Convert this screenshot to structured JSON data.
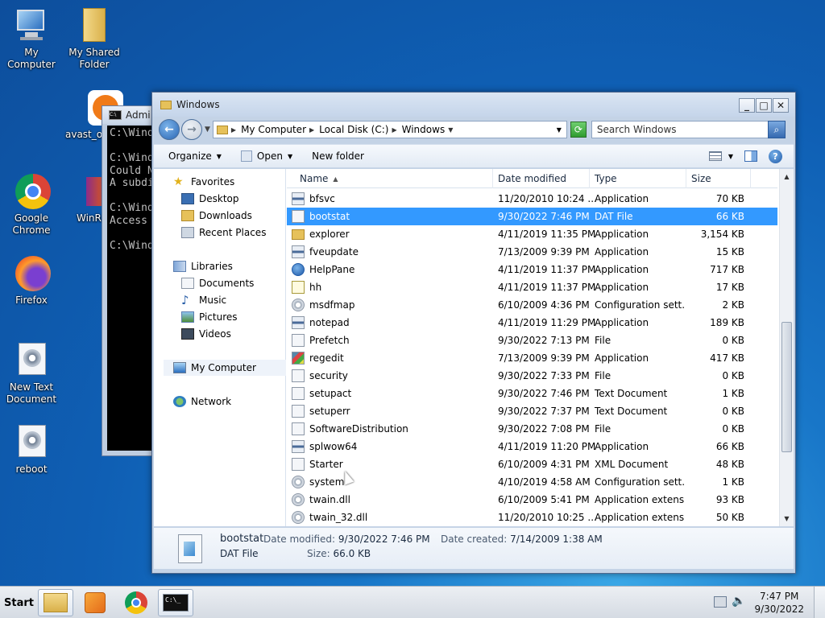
{
  "desktop": {
    "icons": [
      {
        "label": "My Computer"
      },
      {
        "label": "My Shared Folder"
      },
      {
        "label": "avast_on"
      },
      {
        "label": "Google Chrome"
      },
      {
        "label": "WinRa"
      },
      {
        "label": "Firefox"
      },
      {
        "label": "New Text Document"
      },
      {
        "label": "reboot"
      }
    ]
  },
  "cmd": {
    "title": "Admi",
    "lines": "C:\\Wind\n\nC:\\Wind\nCould N\nA subdi\n\nC:\\Wind\nAccess\n\nC:\\Wind"
  },
  "window": {
    "title": "Windows",
    "address": {
      "crumbs": [
        "My Computer",
        "Local Disk (C:)",
        "Windows"
      ]
    },
    "search_placeholder": "Search Windows",
    "toolbar": {
      "organize": "Organize",
      "open": "Open",
      "new_folder": "New folder"
    },
    "nav": {
      "favorites": "Favorites",
      "desktop": "Desktop",
      "downloads": "Downloads",
      "recent": "Recent Places",
      "libraries": "Libraries",
      "documents": "Documents",
      "music": "Music",
      "pictures": "Pictures",
      "videos": "Videos",
      "my_computer": "My Computer",
      "network": "Network"
    },
    "columns": {
      "name": "Name",
      "date": "Date modified",
      "type": "Type",
      "size": "Size"
    },
    "files": [
      {
        "name": "bfsvc",
        "date": "11/20/2010 10:24 ...",
        "type": "Application",
        "size": "70 KB",
        "icon": "app"
      },
      {
        "name": "bootstat",
        "date": "9/30/2022 7:46 PM",
        "type": "DAT File",
        "size": "66 KB",
        "icon": "file",
        "selected": true
      },
      {
        "name": "explorer",
        "date": "4/11/2019 11:35 PM",
        "type": "Application",
        "size": "3,154 KB",
        "icon": "folder"
      },
      {
        "name": "fveupdate",
        "date": "7/13/2009 9:39 PM",
        "type": "Application",
        "size": "15 KB",
        "icon": "app"
      },
      {
        "name": "HelpPane",
        "date": "4/11/2019 11:37 PM",
        "type": "Application",
        "size": "717 KB",
        "icon": "help"
      },
      {
        "name": "hh",
        "date": "4/11/2019 11:37 PM",
        "type": "Application",
        "size": "17 KB",
        "icon": "qmark"
      },
      {
        "name": "msdfmap",
        "date": "6/10/2009 4:36 PM",
        "type": "Configuration sett...",
        "size": "2 KB",
        "icon": "gear"
      },
      {
        "name": "notepad",
        "date": "4/11/2019 11:29 PM",
        "type": "Application",
        "size": "189 KB",
        "icon": "app"
      },
      {
        "name": "Prefetch",
        "date": "9/30/2022 7:13 PM",
        "type": "File",
        "size": "0 KB",
        "icon": "file"
      },
      {
        "name": "regedit",
        "date": "7/13/2009 9:39 PM",
        "type": "Application",
        "size": "417 KB",
        "icon": "reg"
      },
      {
        "name": "security",
        "date": "9/30/2022 7:33 PM",
        "type": "File",
        "size": "0 KB",
        "icon": "file"
      },
      {
        "name": "setupact",
        "date": "9/30/2022 7:46 PM",
        "type": "Text Document",
        "size": "1 KB",
        "icon": "file"
      },
      {
        "name": "setuperr",
        "date": "9/30/2022 7:37 PM",
        "type": "Text Document",
        "size": "0 KB",
        "icon": "file"
      },
      {
        "name": "SoftwareDistribution",
        "date": "9/30/2022 7:08 PM",
        "type": "File",
        "size": "0 KB",
        "icon": "file"
      },
      {
        "name": "splwow64",
        "date": "4/11/2019 11:20 PM",
        "type": "Application",
        "size": "66 KB",
        "icon": "app"
      },
      {
        "name": "Starter",
        "date": "6/10/2009 4:31 PM",
        "type": "XML Document",
        "size": "48 KB",
        "icon": "file"
      },
      {
        "name": "system",
        "date": "4/10/2019 4:58 AM",
        "type": "Configuration sett...",
        "size": "1 KB",
        "icon": "gear"
      },
      {
        "name": "twain.dll",
        "date": "6/10/2009 5:41 PM",
        "type": "Application extens...",
        "size": "93 KB",
        "icon": "gear"
      },
      {
        "name": "twain_32.dll",
        "date": "11/20/2010 10:25 ...",
        "type": "Application extens...",
        "size": "50 KB",
        "icon": "gear"
      }
    ],
    "details": {
      "name": "bootstat",
      "type": "DAT File",
      "modified_label": "Date modified:",
      "modified": "9/30/2022 7:46 PM",
      "created_label": "Date created:",
      "created": "7/14/2009 1:38 AM",
      "size_label": "Size:",
      "size": "66.0 KB"
    }
  },
  "taskbar": {
    "start": "Start",
    "time": "7:47 PM",
    "date": "9/30/2022"
  }
}
